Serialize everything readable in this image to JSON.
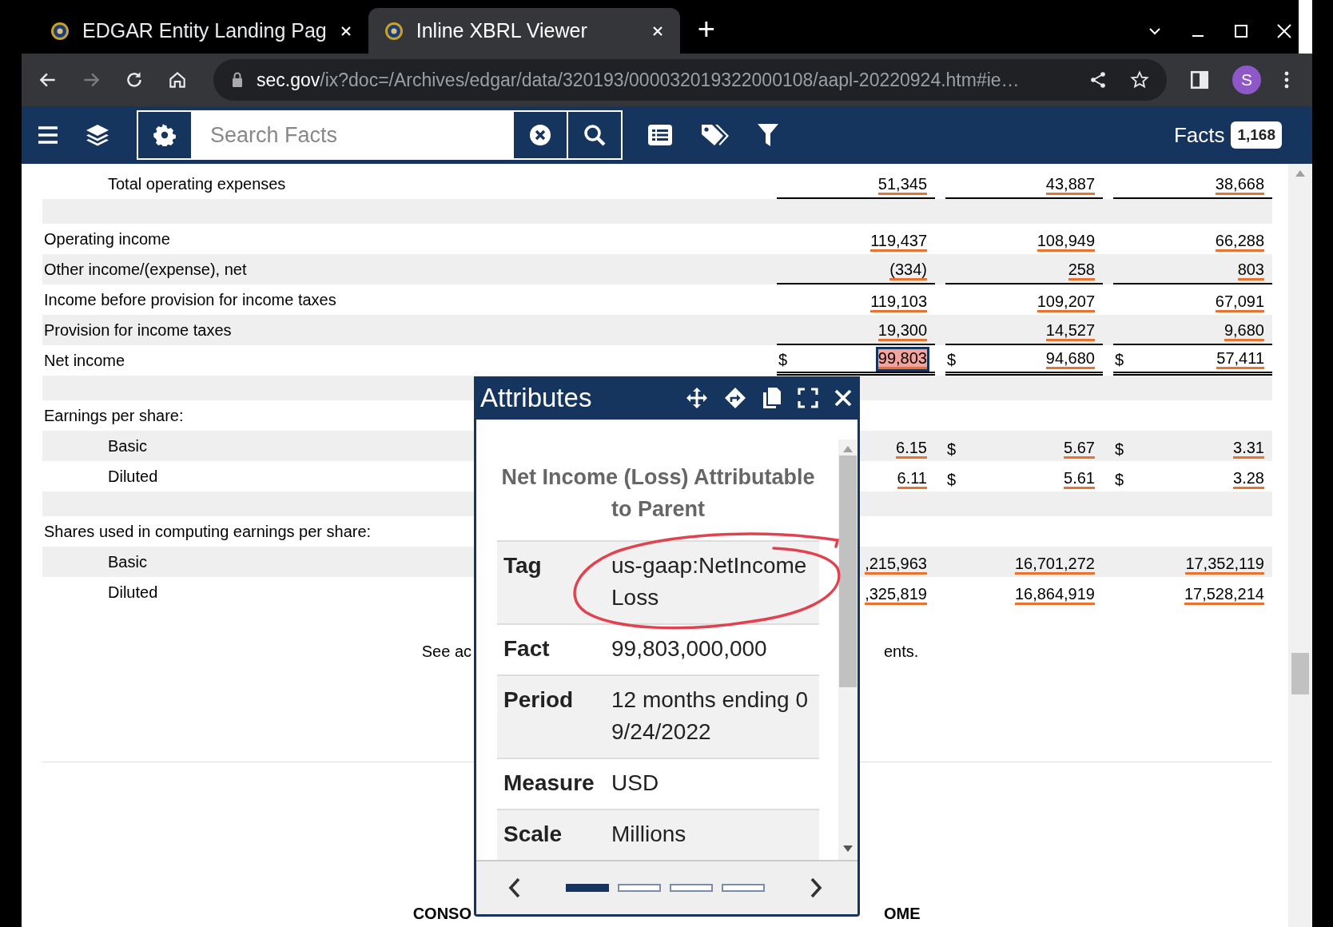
{
  "browser": {
    "tabs": [
      {
        "title": "EDGAR Entity Landing Pag",
        "selected": false
      },
      {
        "title": "Inline XBRL Viewer",
        "selected": true
      }
    ],
    "new_tab": "+",
    "address": {
      "domain": "sec.gov",
      "path": "/ix?doc=/Archives/edgar/data/320193/000032019322000108/aapl-20220924.htm#ie…"
    },
    "forward_disabled": true,
    "profile": "S"
  },
  "toolbar": {
    "search": {
      "placeholder": "Search Facts"
    },
    "facts_label": "Facts",
    "facts_count": "1,168"
  },
  "statement": {
    "rows": [
      {
        "kind": "subtotal",
        "label": "Total operating expenses",
        "indent": true,
        "shaded": false,
        "cells": [
          {
            "value": "51,345",
            "selected": false
          },
          {
            "value": "43,887",
            "selected": false
          },
          {
            "value": "38,668",
            "selected": false
          }
        ]
      },
      {
        "kind": "spacer",
        "shaded": true
      },
      {
        "kind": "line",
        "label": "Operating income",
        "indent": false,
        "shaded": false,
        "cells": [
          {
            "value": "119,437",
            "selected": false
          },
          {
            "value": "108,949",
            "selected": false
          },
          {
            "value": "66,288",
            "selected": false
          }
        ]
      },
      {
        "kind": "subtotal",
        "label": "Other income/(expense), net",
        "indent": false,
        "shaded": true,
        "cells": [
          {
            "value": "(334)",
            "selected": false
          },
          {
            "value": "258",
            "selected": false
          },
          {
            "value": "803",
            "selected": false
          }
        ]
      },
      {
        "kind": "line",
        "label": "Income before provision for income taxes",
        "indent": false,
        "shaded": false,
        "cells": [
          {
            "value": "119,103",
            "selected": false
          },
          {
            "value": "109,207",
            "selected": false
          },
          {
            "value": "67,091",
            "selected": false
          }
        ]
      },
      {
        "kind": "subtotal",
        "label": "Provision for income taxes",
        "indent": false,
        "shaded": true,
        "cells": [
          {
            "value": "19,300",
            "selected": false
          },
          {
            "value": "14,527",
            "selected": false
          },
          {
            "value": "9,680",
            "selected": false
          }
        ]
      },
      {
        "kind": "total",
        "label": "Net income",
        "indent": false,
        "shaded": false,
        "cells": [
          {
            "dollar": "$",
            "value": "99,803",
            "selected": true
          },
          {
            "dollar": "$",
            "value": "94,680",
            "selected": false
          },
          {
            "dollar": "$",
            "value": "57,411",
            "selected": false
          }
        ]
      },
      {
        "kind": "spacer",
        "shaded": true
      },
      {
        "kind": "heading",
        "label": "Earnings per share:",
        "indent": false,
        "shaded": false
      },
      {
        "kind": "line",
        "label": "Basic",
        "indent": true,
        "shaded": true,
        "cells": [
          {
            "value": "6.15",
            "selected": false
          },
          {
            "dollar": "$",
            "value": "5.67",
            "selected": false
          },
          {
            "dollar": "$",
            "value": "3.31",
            "selected": false
          }
        ]
      },
      {
        "kind": "line",
        "label": "Diluted",
        "indent": true,
        "shaded": false,
        "cells": [
          {
            "value": "6.11",
            "selected": false
          },
          {
            "dollar": "$",
            "value": "5.61",
            "selected": false
          },
          {
            "dollar": "$",
            "value": "3.28",
            "selected": false
          }
        ]
      },
      {
        "kind": "spacer",
        "shaded": true
      },
      {
        "kind": "heading",
        "label": "Shares used in computing earnings per share:",
        "indent": false,
        "shaded": false
      },
      {
        "kind": "line",
        "label": "Basic",
        "indent": true,
        "shaded": true,
        "cells": [
          {
            "value": ",215,963",
            "selected": false
          },
          {
            "value": "16,701,272",
            "selected": false
          },
          {
            "value": "17,352,119",
            "selected": false
          }
        ]
      },
      {
        "kind": "line",
        "label": "Diluted",
        "indent": true,
        "shaded": false,
        "cells": [
          {
            "value": ",325,819",
            "selected": false
          },
          {
            "value": "16,864,919",
            "selected": false
          },
          {
            "value": "17,528,214",
            "selected": false
          }
        ]
      }
    ],
    "footnote": [
      "See ac",
      "ents."
    ],
    "next_heading": [
      "CONSO",
      "OME"
    ]
  },
  "attributes": {
    "title": "Attributes",
    "concept": "Net Income (Loss) Attributable to Parent",
    "fields": [
      {
        "label": "Tag",
        "value": "us-gaap:NetIncomeLoss",
        "shaded": true
      },
      {
        "label": "Fact",
        "value": "99,803,000,000",
        "shaded": false
      },
      {
        "label": "Period",
        "value": "12 months ending 09/24/2022",
        "shaded": true
      },
      {
        "label": "Measure",
        "value": "USD",
        "shaded": false
      },
      {
        "label": "Scale",
        "value": "Millions",
        "shaded": true
      }
    ],
    "pages": [
      {
        "selected": true
      },
      {
        "selected": false
      },
      {
        "selected": false
      },
      {
        "selected": false
      }
    ]
  }
}
